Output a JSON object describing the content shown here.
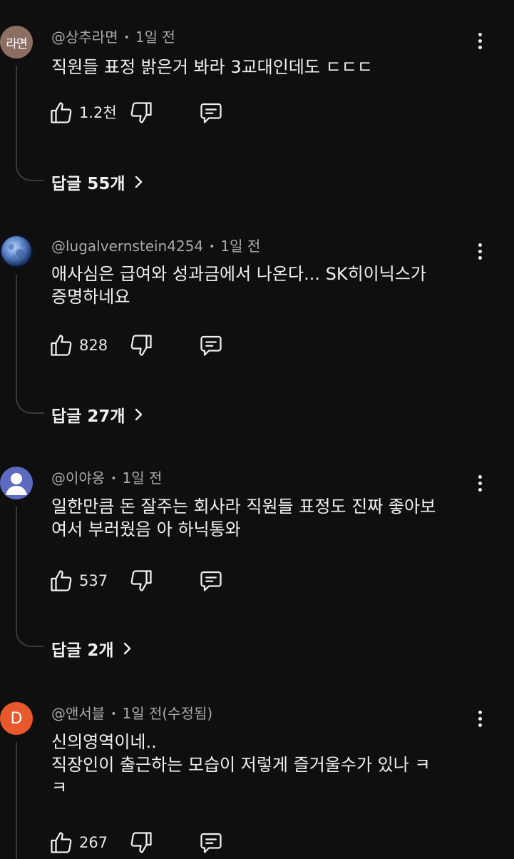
{
  "comments": [
    {
      "avatar_text": "라면",
      "avatar_color": "#8d6e63",
      "handle": "@상추라면",
      "time": "1일 전",
      "text": "직원들 표정 밝은거 봐라 3교대인데도 ㄷㄷㄷ",
      "likes": "1.2천",
      "replies_label": "답글 55개"
    },
    {
      "avatar_icon": "moon-avatar",
      "handle": "@lugalvernstein4254",
      "time": "1일 전",
      "text": "애사심은 급여와 성과금에서 나온다... SK히이닉스가\n증명하네요",
      "likes": "828",
      "replies_label": "답글 27개"
    },
    {
      "avatar_icon": "default-user-avatar",
      "avatar_color": "#5c6bc0",
      "handle": "@이야옹",
      "time": "1일 전",
      "text": "일한만큼 돈 잘주는 회사라 직원들 표정도 진짜 좋아보\n여서 부러웠음 아 하닉통와",
      "likes": "537",
      "replies_label": "답글 2개"
    },
    {
      "avatar_text": "D",
      "avatar_color": "#e8582d",
      "handle": "@앤서블",
      "time": "1일 전(수정됨)",
      "text": "신의영역이네..\n직장인이 출근하는 모습이 저렇게 즐거울수가 있나 ㅋ\nㅋ",
      "likes": "267"
    }
  ],
  "icons": {
    "like": "thumbs-up-icon",
    "dislike": "thumbs-down-icon",
    "reply": "comment-reply-icon",
    "more": "more-vertical-icon",
    "replies_arrow": "chevron-right-icon"
  }
}
